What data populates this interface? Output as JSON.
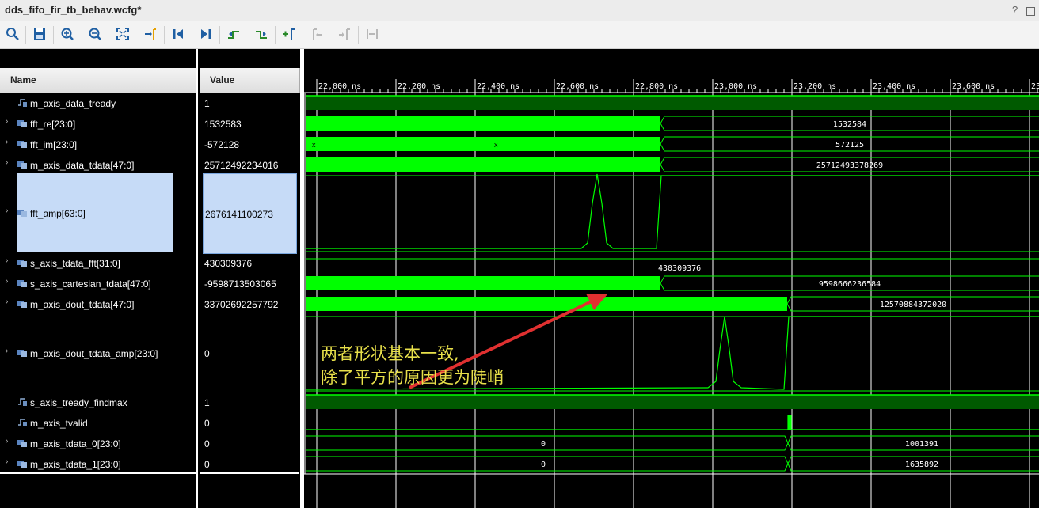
{
  "window": {
    "title": "dds_fifo_fir_tb_behav.wcfg*",
    "help": "?"
  },
  "toolbar": {
    "icons": [
      "search-icon",
      "save-icon",
      "zoom-in-icon",
      "zoom-out-icon",
      "zoom-fit-icon",
      "go-to-cursor-icon",
      "go-to-time-0-icon",
      "go-to-last-time-icon",
      "previous-transition-icon",
      "next-transition-icon",
      "add-marker-icon",
      "previous-marker-icon",
      "next-marker-icon",
      "swap-cursors-icon"
    ]
  },
  "columns": {
    "name": "Name",
    "value": "Value"
  },
  "signals": [
    {
      "name": "m_axis_data_tready",
      "value": "1",
      "expandable": false,
      "kind": "bit"
    },
    {
      "name": "fft_re[23:0]",
      "value": "1532583",
      "expandable": true,
      "kind": "bus"
    },
    {
      "name": "fft_im[23:0]",
      "value": "-572128",
      "expandable": true,
      "kind": "bus"
    },
    {
      "name": "m_axis_data_tdata[47:0]",
      "value": "25712492234016",
      "expandable": true,
      "kind": "bus"
    },
    {
      "name": "fft_amp[63:0]",
      "value": "2676141100273",
      "expandable": true,
      "kind": "analog",
      "selected": true
    },
    {
      "name": "s_axis_tdata_fft[31:0]",
      "value": "430309376",
      "expandable": true,
      "kind": "bus"
    },
    {
      "name": "s_axis_cartesian_tdata[47:0]",
      "value": "-9598713503065",
      "expandable": true,
      "kind": "bus"
    },
    {
      "name": "m_axis_dout_tdata[47:0]",
      "value": "33702692257792",
      "expandable": true,
      "kind": "bus"
    },
    {
      "name": "m_axis_dout_tdata_amp[23:0]",
      "value": "0",
      "expandable": true,
      "kind": "analog"
    },
    {
      "name": "s_axis_tready_findmax",
      "value": "1",
      "expandable": false,
      "kind": "bit"
    },
    {
      "name": "m_axis_tvalid",
      "value": "0",
      "expandable": false,
      "kind": "bit"
    },
    {
      "name": "m_axis_tdata_0[23:0]",
      "value": "0",
      "expandable": true,
      "kind": "bus"
    },
    {
      "name": "m_axis_tdata_1[23:0]",
      "value": "0",
      "expandable": true,
      "kind": "bus"
    }
  ],
  "timeline": {
    "ticks": [
      "22,000 ns",
      "22,200 ns",
      "22,400 ns",
      "22,600 ns",
      "22,800 ns",
      "23,000 ns",
      "23,200 ns",
      "23,400 ns",
      "23,600 ns",
      "23"
    ]
  },
  "wave_labels": {
    "fft_re": "1532584",
    "fft_im": "572125",
    "m_axis_data_tdata": "25712493378269",
    "s_axis_tdata_fft": "430309376",
    "s_axis_cartesian_tdata": "9598666236584",
    "m_axis_dout_tdata": "12570884372020",
    "m_axis_tdata_0_a": "0",
    "m_axis_tdata_0_b": "1001391",
    "m_axis_tdata_1_a": "0",
    "m_axis_tdata_1_b": "1635892"
  },
  "annotation": {
    "line1": "两者形状基本一致,",
    "line2": "除了平方的原因更为陡峭"
  },
  "colors": {
    "wave": "#00ff00",
    "bit_high_fill": "#005a00",
    "background": "#000000",
    "annotation": "#e8e04a",
    "arrow": "#e03030",
    "selection": "#c6dbf7"
  }
}
